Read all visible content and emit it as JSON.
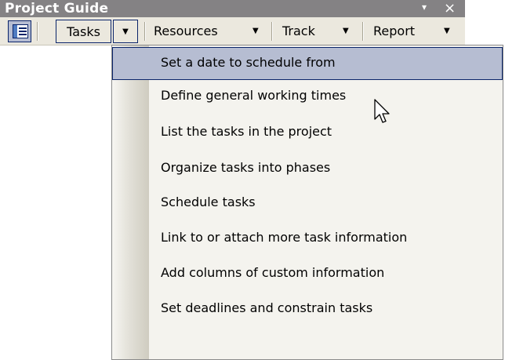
{
  "titlebar": {
    "title": "Project Guide",
    "dropdown_glyph": "▾",
    "close_glyph": "×"
  },
  "toolbar": {
    "icon": "project-guide-icon",
    "tabs": [
      {
        "label": "Tasks",
        "pressed": true
      },
      {
        "label": "Resources",
        "pressed": false
      },
      {
        "label": "Track",
        "pressed": false
      },
      {
        "label": "Report",
        "pressed": false
      }
    ],
    "arrow_glyph": "▼"
  },
  "menu": {
    "items": [
      {
        "label": "Set a date to schedule from",
        "selected": true
      },
      {
        "label": "Define general working times",
        "selected": false
      },
      {
        "label": "List the tasks in the project",
        "selected": false
      },
      {
        "label": "Organize tasks into phases",
        "selected": false
      },
      {
        "label": "Schedule tasks",
        "selected": false
      },
      {
        "label": "Link to or attach more task information",
        "selected": false
      },
      {
        "label": "Add columns of custom information",
        "selected": false
      },
      {
        "label": "Set deadlines and constrain tasks",
        "selected": false
      }
    ]
  },
  "colors": {
    "titlebar_bg": "#848284",
    "toolbar_bg": "#ebe8de",
    "selection_bg": "#b6bdd2",
    "selection_border": "#0a246a",
    "menu_bg": "#f4f3ee"
  }
}
